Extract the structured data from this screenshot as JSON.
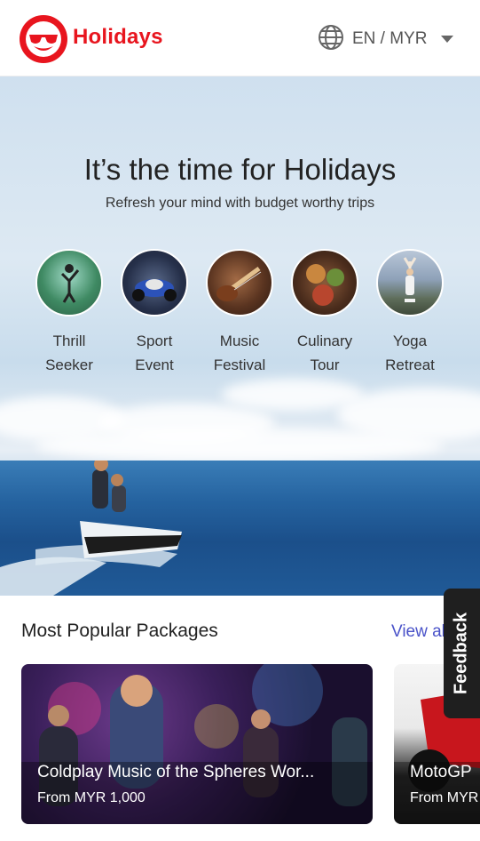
{
  "header": {
    "brand": "Holidays",
    "language_currency": "EN / MYR",
    "logo_icon": "smiley-sunglasses-icon",
    "brand_color": "#e8151e"
  },
  "hero": {
    "title": "It’s the time for Holidays",
    "subtitle": "Refresh your mind with budget worthy trips",
    "categories": [
      {
        "line1": "Thrill",
        "line2": "Seeker"
      },
      {
        "line1": "Sport",
        "line2": "Event"
      },
      {
        "line1": "Music",
        "line2": "Festival"
      },
      {
        "line1": "Culinary",
        "line2": "Tour"
      },
      {
        "line1": "Yoga",
        "line2": "Retreat"
      }
    ]
  },
  "popular": {
    "title": "Most Popular Packages",
    "view_all": "View all",
    "cards": [
      {
        "title": "Coldplay Music of the Spheres Wor...",
        "price": "From MYR 1,000"
      },
      {
        "title": "MotoGP",
        "price": "From MYR"
      }
    ]
  },
  "feedback": {
    "label": "Feedback"
  },
  "colors": {
    "accent": "#4a53c9",
    "feedback_bg": "#1f1f1f"
  }
}
